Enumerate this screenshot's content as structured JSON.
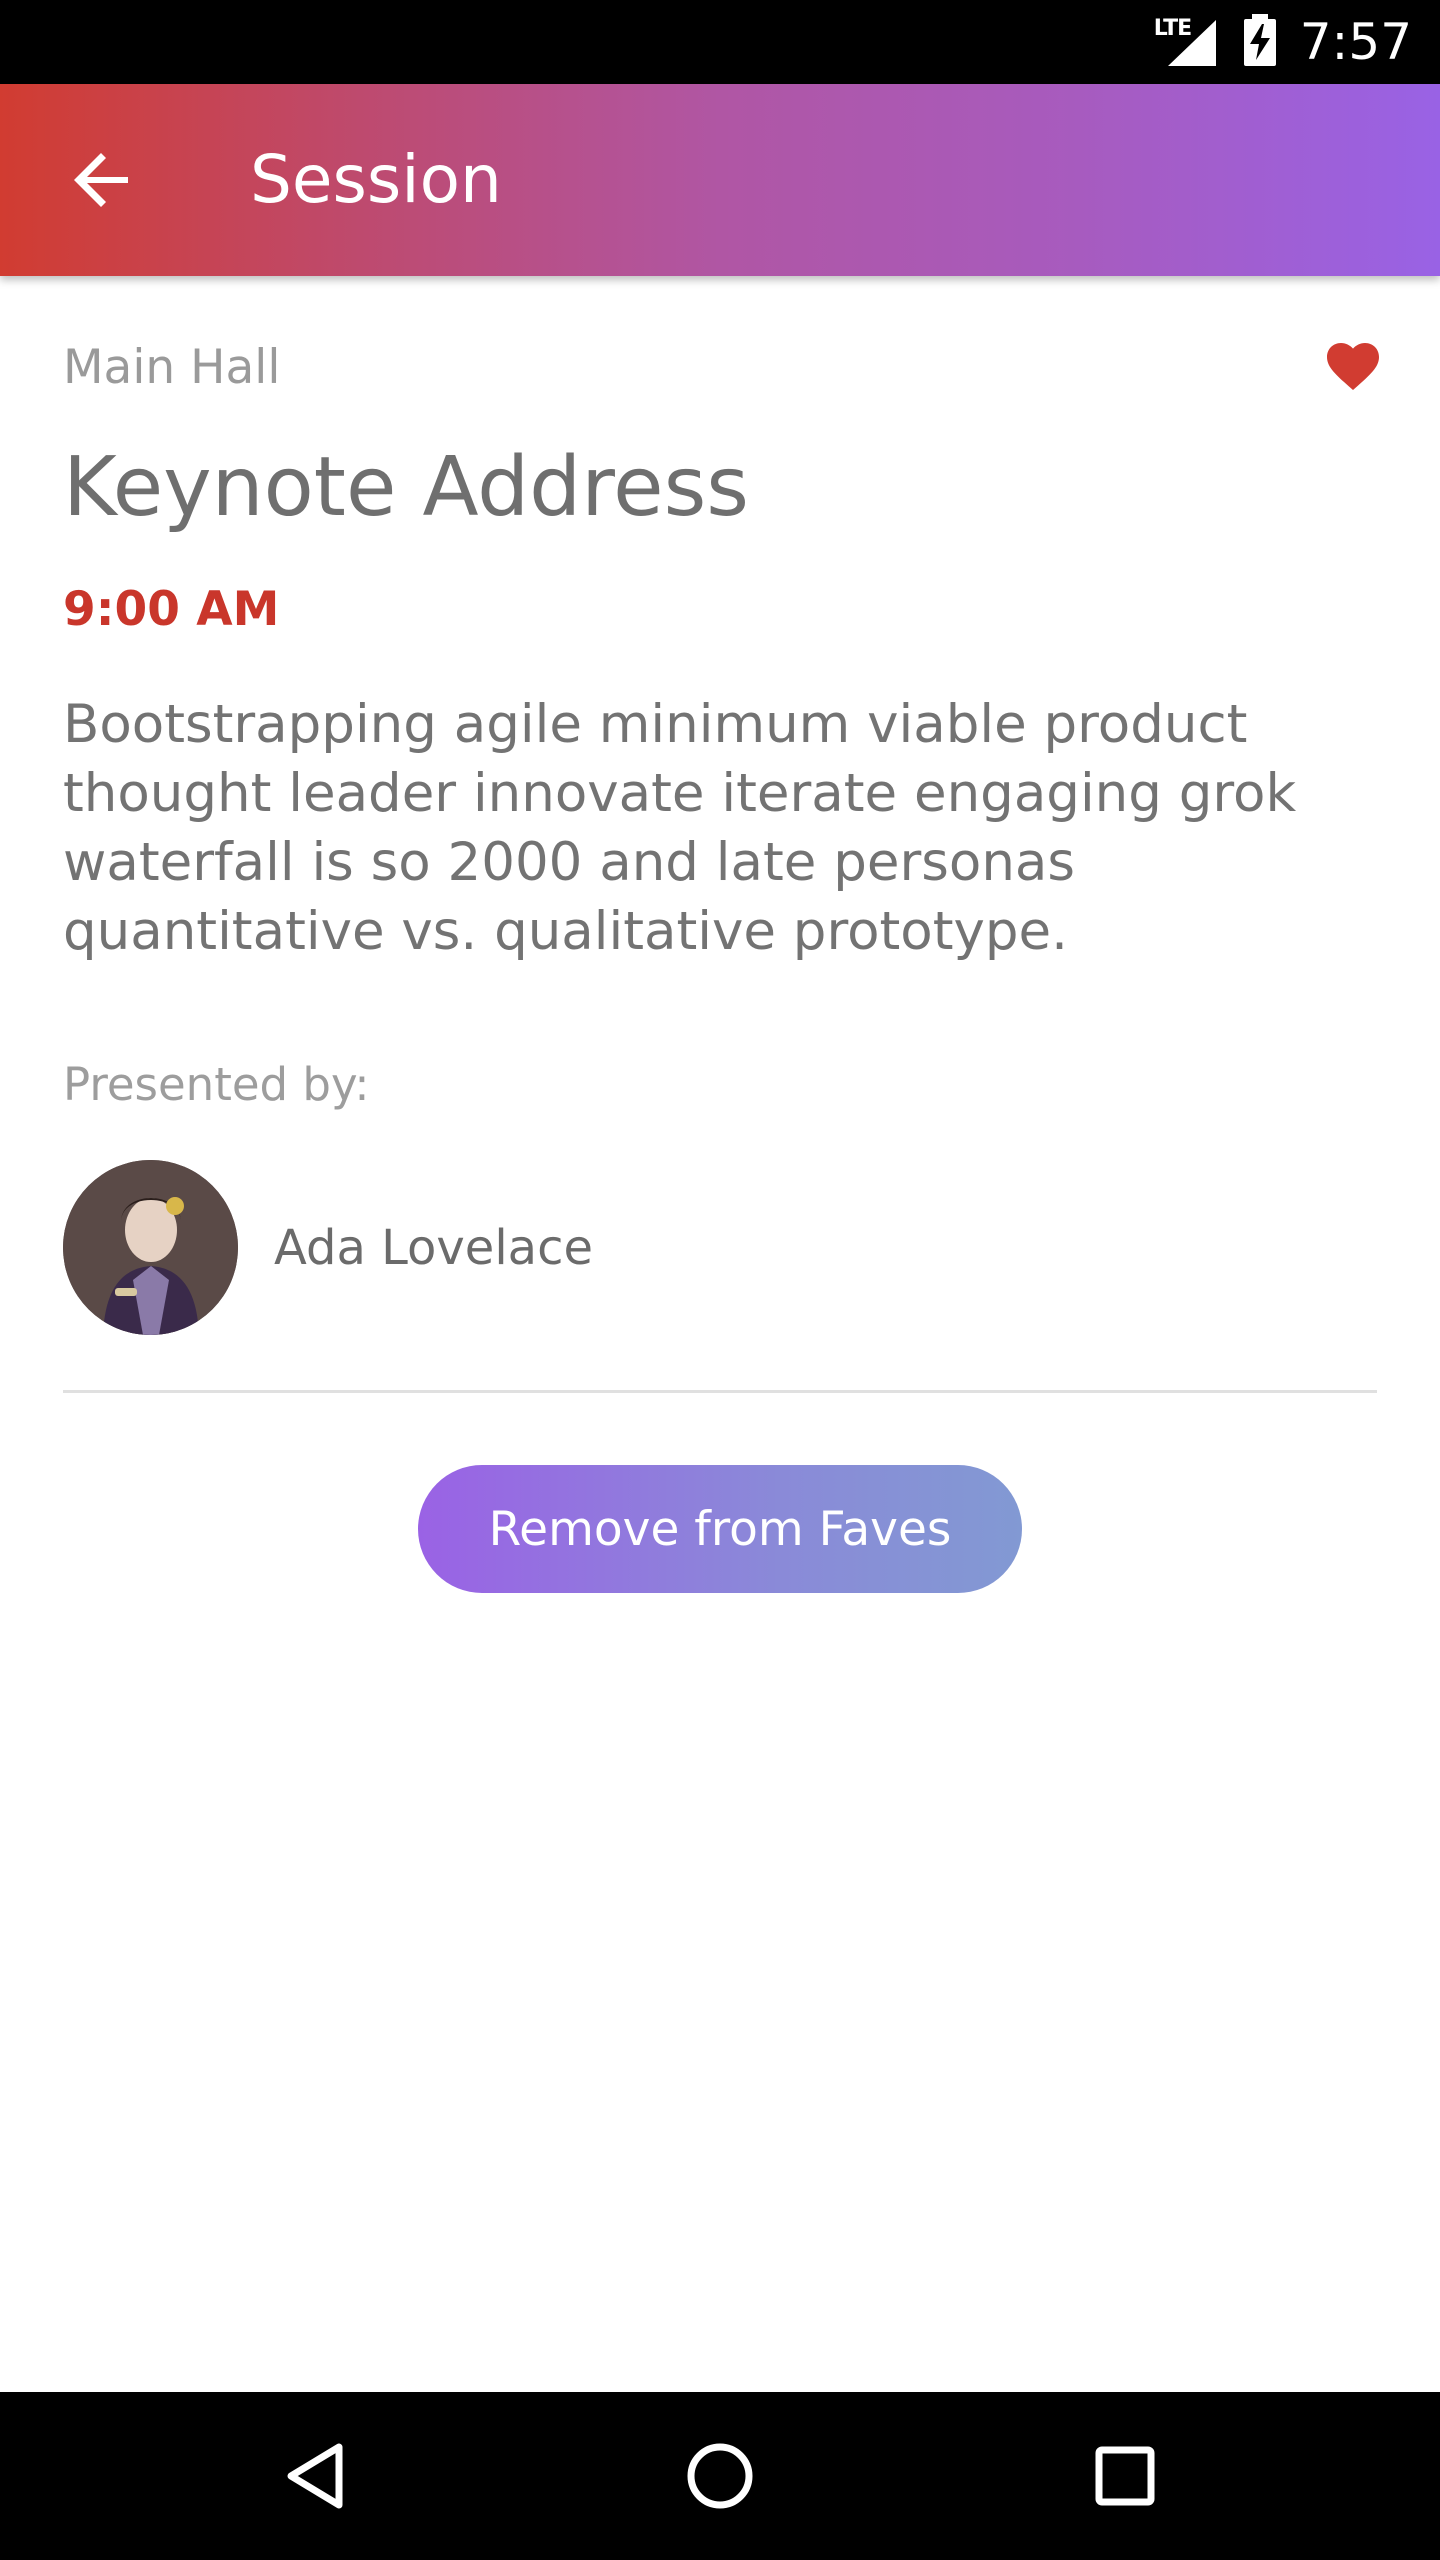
{
  "status_bar": {
    "network": "LTE",
    "time": "7:57"
  },
  "app_bar": {
    "title": "Session",
    "back_icon": "arrow-back-icon",
    "gradient": [
      "#d13c31",
      "#9962e5"
    ]
  },
  "session": {
    "location": "Main Hall",
    "favorite": true,
    "favorite_icon": "heart-icon",
    "title": "Keynote Address",
    "time": "9:00 AM",
    "description": "Bootstrapping agile minimum viable product thought leader innovate iterate engaging grok waterfall is so 2000 and late personas quantitative vs. qualitative prototype.",
    "presented_label": "Presented by:",
    "speakers": [
      {
        "name": "Ada Lovelace"
      }
    ]
  },
  "actions": {
    "remove_label": "Remove from Faves"
  },
  "colors": {
    "accent_red": "#c9362b",
    "button_gradient": [
      "#9a62e5",
      "#8299d3"
    ]
  },
  "nav_bar": {
    "icons": [
      "back-triangle-icon",
      "home-circle-icon",
      "recents-square-icon"
    ]
  }
}
